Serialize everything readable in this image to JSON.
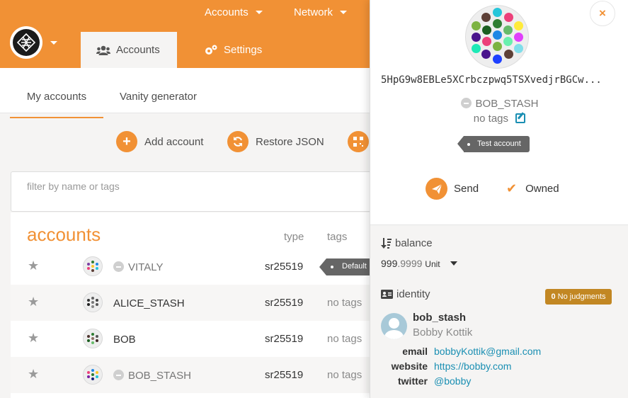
{
  "colors": {
    "accent": "#f19135",
    "link": "#1a8fb3",
    "tag": "#666666",
    "judgement": "#c28723"
  },
  "topnav": {
    "accounts_menu": "Accounts",
    "network_menu": "Network"
  },
  "tabs": {
    "accounts": "Accounts",
    "settings": "Settings"
  },
  "subnav": {
    "my_accounts": "My accounts",
    "vanity": "Vanity generator"
  },
  "actions": {
    "add": "Add account",
    "restore": "Restore JSON"
  },
  "filter": {
    "placeholder": "filter by name or tags"
  },
  "table": {
    "title": "accounts",
    "col_type": "type",
    "col_tags": "tags",
    "rows": [
      {
        "name": "VITALY",
        "type": "sr25519",
        "tags": "Default"
      },
      {
        "name": "ALICE_STASH",
        "type": "sr25519",
        "tags": "no tags"
      },
      {
        "name": "BOB",
        "type": "sr25519",
        "tags": "no tags"
      },
      {
        "name": "BOB_STASH",
        "type": "sr25519",
        "tags": "no tags"
      }
    ]
  },
  "sidebar": {
    "close": "×",
    "address": "5HpG9w8EBLe5XCrbczpwq5TSXvedjrBGCw...",
    "name": "BOB_STASH",
    "no_tags": "no tags",
    "tag": "Test account",
    "send": "Send",
    "owned": "Owned",
    "balance_label": "balance",
    "balance_int": "999",
    "balance_dec": ".9999",
    "balance_unit": "Unit",
    "identity_label": "identity",
    "judgements_count": "0",
    "judgements_text": "No judgments",
    "id_display": "bob_stash",
    "id_legal": "Bobby Kottik",
    "email_label": "email",
    "email": "bobbyKottik@gmail.com",
    "website_label": "website",
    "website": "https://bobby.com",
    "twitter_label": "twitter",
    "twitter": "@bobby"
  }
}
